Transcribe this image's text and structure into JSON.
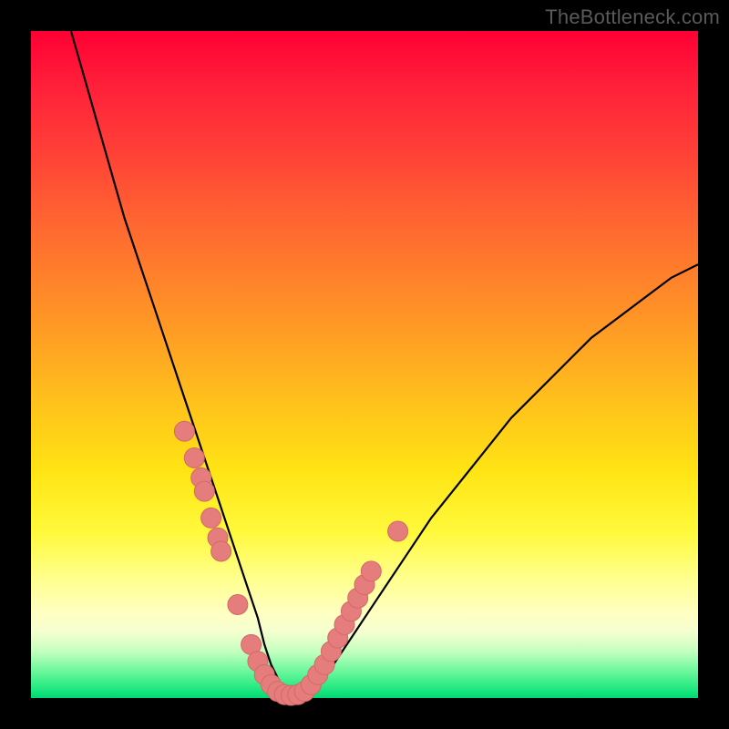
{
  "watermark": "TheBottleneck.com",
  "colors": {
    "curve": "#000000",
    "marker_fill": "#e57d7d",
    "marker_stroke": "#d56868"
  },
  "chart_data": {
    "type": "line",
    "title": "",
    "xlabel": "",
    "ylabel": "",
    "xlim": [
      0,
      100
    ],
    "ylim": [
      0,
      100
    ],
    "grid": false,
    "legend": false,
    "series": [
      {
        "name": "bottleneck-curve",
        "x": [
          6,
          8,
          10,
          12,
          14,
          16,
          18,
          20,
          22,
          24,
          26,
          28,
          30,
          32,
          34,
          35,
          36,
          37,
          38,
          40,
          42,
          44,
          46,
          48,
          52,
          56,
          60,
          64,
          68,
          72,
          76,
          80,
          84,
          88,
          92,
          96,
          100
        ],
        "values": [
          100,
          93,
          86,
          79,
          72,
          66,
          60,
          54,
          48,
          42,
          36,
          30,
          24,
          18,
          12,
          8,
          5,
          3,
          1,
          0.5,
          1,
          3,
          6,
          9,
          15,
          21,
          27,
          32,
          37,
          42,
          46,
          50,
          54,
          57,
          60,
          63,
          65
        ]
      }
    ],
    "markers": [
      {
        "x": 23.0,
        "y": 40.0
      },
      {
        "x": 24.5,
        "y": 36.0
      },
      {
        "x": 25.5,
        "y": 33.0
      },
      {
        "x": 26.0,
        "y": 31.0
      },
      {
        "x": 27.0,
        "y": 27.0
      },
      {
        "x": 28.0,
        "y": 24.0
      },
      {
        "x": 28.5,
        "y": 22.0
      },
      {
        "x": 31.0,
        "y": 14.0
      },
      {
        "x": 33.0,
        "y": 8.0
      },
      {
        "x": 34.0,
        "y": 5.5
      },
      {
        "x": 35.0,
        "y": 3.5
      },
      {
        "x": 36.0,
        "y": 2.0
      },
      {
        "x": 37.0,
        "y": 1.0
      },
      {
        "x": 38.0,
        "y": 0.5
      },
      {
        "x": 39.0,
        "y": 0.4
      },
      {
        "x": 40.0,
        "y": 0.5
      },
      {
        "x": 41.0,
        "y": 1.0
      },
      {
        "x": 42.0,
        "y": 2.0
      },
      {
        "x": 43.0,
        "y": 3.5
      },
      {
        "x": 44.0,
        "y": 5.0
      },
      {
        "x": 45.0,
        "y": 7.0
      },
      {
        "x": 46.0,
        "y": 9.0
      },
      {
        "x": 47.0,
        "y": 11.0
      },
      {
        "x": 48.0,
        "y": 13.0
      },
      {
        "x": 49.0,
        "y": 15.0
      },
      {
        "x": 50.0,
        "y": 17.0
      },
      {
        "x": 51.0,
        "y": 19.0
      },
      {
        "x": 55.0,
        "y": 25.0
      }
    ],
    "marker_radius_percent": 1.5
  }
}
